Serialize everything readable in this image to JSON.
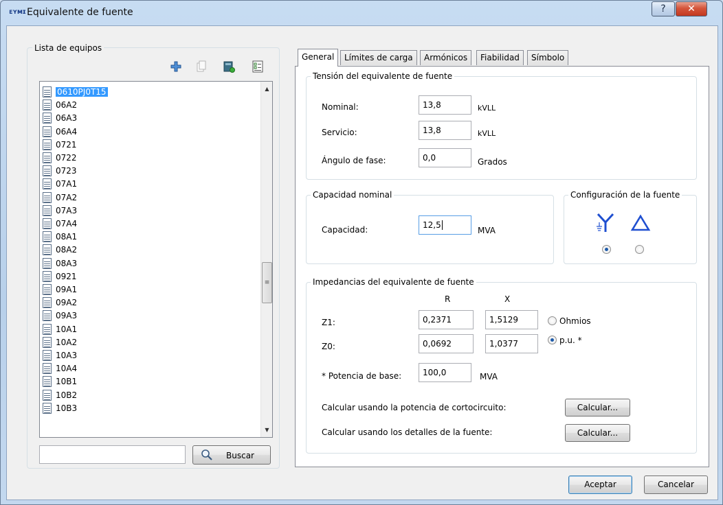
{
  "window": {
    "title": "Equivalente de fuente",
    "app_icon_text": "ᴇʏᴍɪ",
    "help_label": "?",
    "close_label": "✕"
  },
  "left": {
    "group_title": "Lista de equipos",
    "items": [
      "0610PJ0T15",
      "06A2",
      "06A3",
      "06A4",
      "0721",
      "0722",
      "0723",
      "07A1",
      "07A2",
      "07A3",
      "07A4",
      "08A1",
      "08A2",
      "08A3",
      "0921",
      "09A1",
      "09A2",
      "09A3",
      "10A1",
      "10A2",
      "10A3",
      "10A4",
      "10B1",
      "10B2",
      "10B3"
    ],
    "selected_index": 0,
    "search_value": "",
    "search_button": "Buscar"
  },
  "tabs": [
    "General",
    "Límites de carga",
    "Armónicos",
    "Fiabilidad",
    "Símbolo"
  ],
  "tension": {
    "title": "Tensión del equivalente de fuente",
    "nominal_label": "Nominal:",
    "nominal_value": "13,8",
    "nominal_unit": "kVLL",
    "servicio_label": "Servicio:",
    "servicio_value": "13,8",
    "servicio_unit": "kVLL",
    "angulo_label": "Ángulo de fase:",
    "angulo_value": "0,0",
    "angulo_unit": "Grados"
  },
  "capacidad": {
    "title": "Capacidad nominal",
    "label": "Capacidad:",
    "value": "12,5",
    "unit": "MVA"
  },
  "configuracion": {
    "title": "Configuración de la fuente",
    "wye_selected": true
  },
  "impedancias": {
    "title": "Impedancias del equivalente de fuente",
    "col_r": "R",
    "col_x": "X",
    "z1_label": "Z1:",
    "z1_r": "0,2371",
    "z1_x": "1,5129",
    "z0_label": "Z0:",
    "z0_r": "0,0692",
    "z0_x": "1,0377",
    "ohmios_label": "Ohmios",
    "pu_label": "p.u. *",
    "pu_selected": true,
    "base_label": "* Potencia de base:",
    "base_value": "100,0",
    "base_unit": "MVA",
    "calc1_label": "Calcular usando la potencia de cortocircuito:",
    "calc2_label": "Calcular usando los detalles de la fuente:",
    "calc_button": "Calcular..."
  },
  "footer": {
    "ok": "Aceptar",
    "cancel": "Cancelar"
  }
}
